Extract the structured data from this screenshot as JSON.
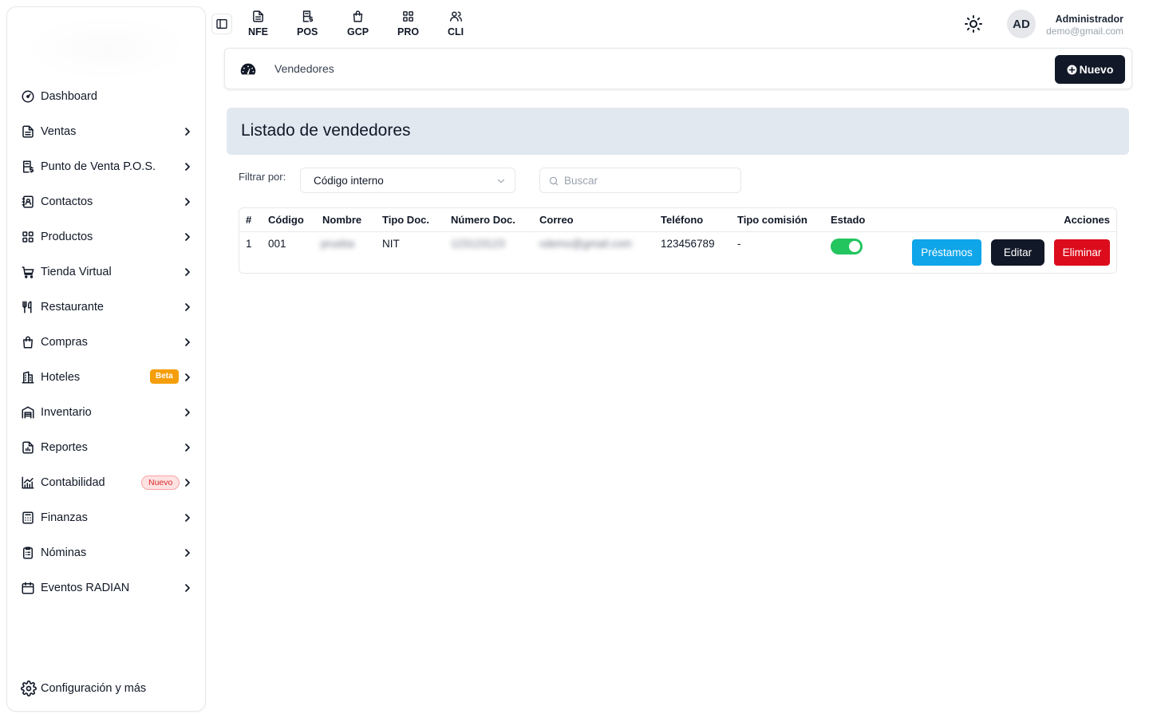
{
  "sidebar": {
    "items": [
      {
        "label": "Dashboard",
        "icon": "gauge-icon"
      },
      {
        "label": "Ventas",
        "icon": "document-icon"
      },
      {
        "label": "Punto de Venta P.O.S.",
        "icon": "pos-receipt-icon"
      },
      {
        "label": "Contactos",
        "icon": "contacts-icon"
      },
      {
        "label": "Productos",
        "icon": "grid-icon"
      },
      {
        "label": "Tienda Virtual",
        "icon": "cart-icon"
      },
      {
        "label": "Restaurante",
        "icon": "utensils-icon"
      },
      {
        "label": "Compras",
        "icon": "shopping-bag-icon"
      },
      {
        "label": "Hoteles",
        "icon": "building-icon",
        "badge": "Beta"
      },
      {
        "label": "Inventario",
        "icon": "warehouse-icon"
      },
      {
        "label": "Reportes",
        "icon": "report-icon"
      },
      {
        "label": "Contabilidad",
        "icon": "chart-icon",
        "badge": "Nuevo"
      },
      {
        "label": "Finanzas",
        "icon": "calculator-icon"
      },
      {
        "label": "Nóminas",
        "icon": "clipboard-icon"
      },
      {
        "label": "Eventos RADIAN",
        "icon": "calendar-icon"
      }
    ],
    "config_label": "Configuración y más"
  },
  "topnav": {
    "items": [
      {
        "label": "NFE",
        "icon": "document-icon"
      },
      {
        "label": "POS",
        "icon": "pos-receipt-icon"
      },
      {
        "label": "GCP",
        "icon": "shopping-bag-icon"
      },
      {
        "label": "PRO",
        "icon": "grid-icon"
      },
      {
        "label": "CLI",
        "icon": "users-icon"
      }
    ]
  },
  "user": {
    "initials": "AD",
    "name": "Administrador",
    "email": "demo@gmail.com"
  },
  "breadcrumb": {
    "current": "Vendedores",
    "new_button": "Nuevo"
  },
  "page": {
    "title": "Listado de vendedores"
  },
  "filters": {
    "label": "Filtrar por:",
    "selected": "Código interno",
    "search_placeholder": "Buscar"
  },
  "table": {
    "headers": [
      "#",
      "Código",
      "Nombre",
      "Tipo Doc.",
      "Número Doc.",
      "Correo",
      "Teléfono",
      "Tipo comisión",
      "Estado",
      "Acciones"
    ],
    "rows": [
      {
        "num": "1",
        "codigo": "001",
        "nombre": "prueba",
        "tipo_doc": "NIT",
        "numero_doc": "123123123",
        "correo": "vdemo@gmail.com",
        "telefono": "123456789",
        "tipo_comision": "-",
        "estado_activo": true
      }
    ],
    "actions": {
      "loans": "Préstamos",
      "edit": "Editar",
      "delete": "Eliminar"
    }
  },
  "colors": {
    "primary_dark": "#111827",
    "info": "#0ea5e9",
    "danger": "#dc0c1c",
    "success": "#22c55e",
    "beta_badge": "#f59e0b"
  }
}
